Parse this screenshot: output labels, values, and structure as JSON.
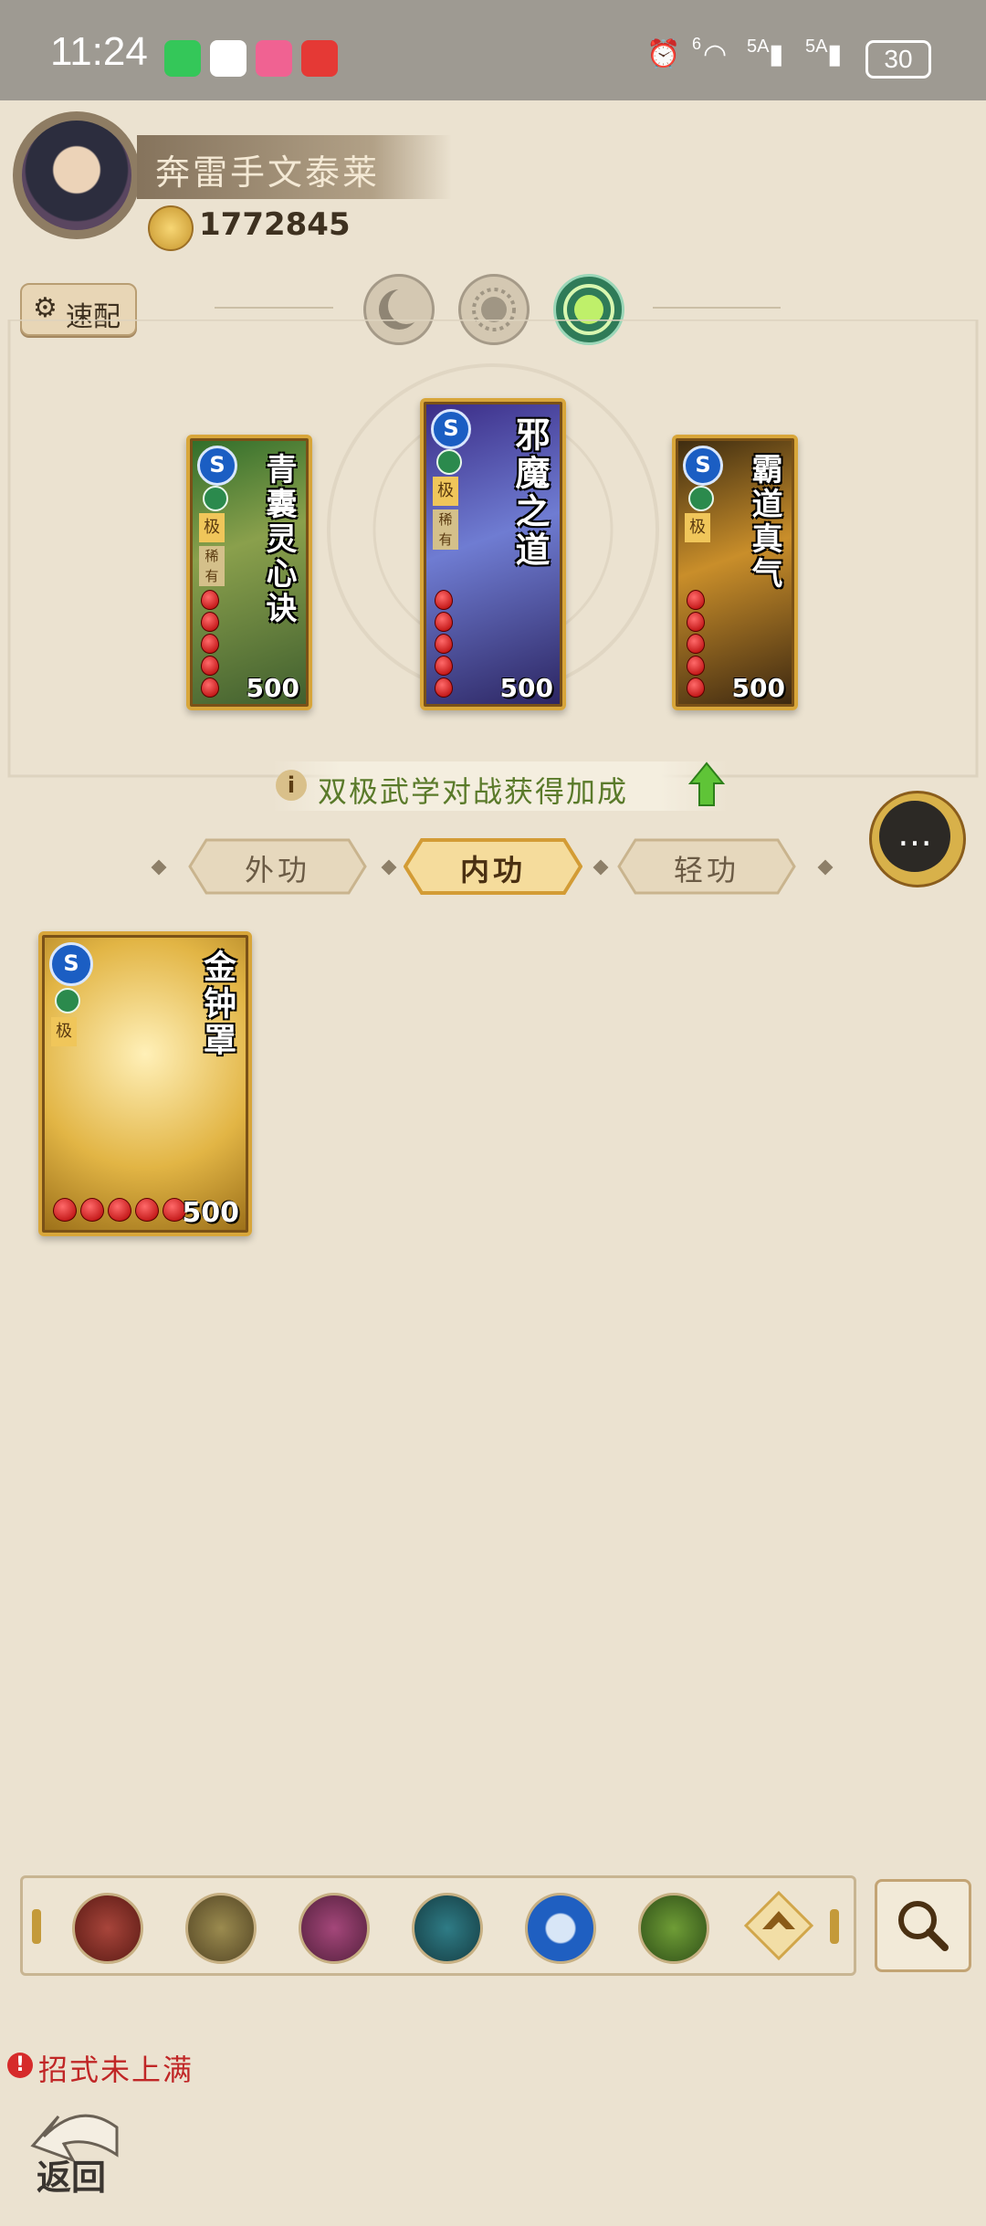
{
  "status_bar": {
    "time": "11:24",
    "signal_1": "5A",
    "signal_2": "5A",
    "wifi_sup": "6",
    "battery": "30"
  },
  "player": {
    "name": "奔雷手文泰莱",
    "coins": "1772845"
  },
  "quick_config": {
    "label": "速配"
  },
  "cards_equipped": [
    {
      "name": "青囊灵心诀",
      "value": "500",
      "tag1": "极",
      "tag2": "稀有",
      "gems": 5
    },
    {
      "name": "邪魔之道",
      "value": "500",
      "tag1": "极",
      "tag2": "稀有",
      "gems": 5
    },
    {
      "name": "霸道真气",
      "value": "500",
      "tag1": "极",
      "tag2": "",
      "gems": 5
    }
  ],
  "bonus_text": "双极武学对战获得加成",
  "tabs": [
    {
      "label": "外功"
    },
    {
      "label": "内功"
    },
    {
      "label": "轻功"
    }
  ],
  "inventory_card": {
    "name": "金钟罩",
    "value": "500",
    "tag1": "极",
    "gems": 5
  },
  "warning_text": "招式未上满",
  "back_label": "返回",
  "colors": {
    "background": "#ebe2d0",
    "gold_border": "#d8a63a",
    "bonus_green": "#5a7a2a",
    "warning_red": "#c02626"
  },
  "icons": {
    "style_moon": "crescent-moon-icon",
    "style_sun": "sun-icon",
    "style_green": "green-moon-sun-icon",
    "filters": [
      "blade-icon",
      "sword-icon",
      "fist-icon",
      "fan-icon",
      "yinyang-icon",
      "hand-icon",
      "arrow-up-icon"
    ]
  }
}
